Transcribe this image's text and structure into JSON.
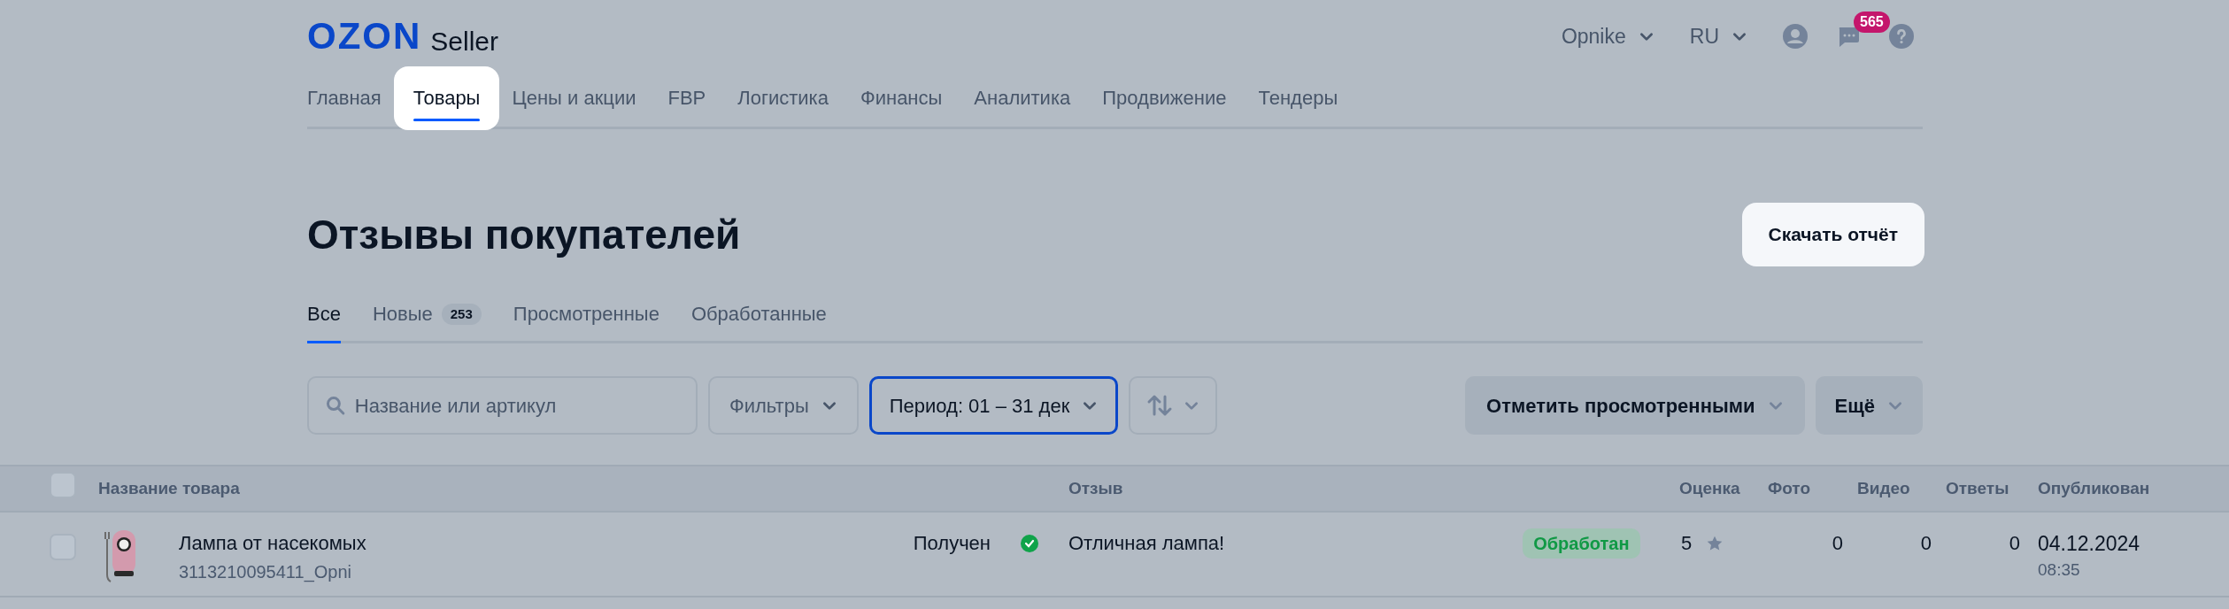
{
  "header": {
    "logo": "OZON",
    "logo_suffix": "Seller",
    "account": "Opnike",
    "language": "RU",
    "messages_badge": "565"
  },
  "nav": [
    {
      "label": "Главная",
      "selected": false
    },
    {
      "label": "Товары",
      "selected": true
    },
    {
      "label": "Цены и акции",
      "selected": false
    },
    {
      "label": "FBP",
      "selected": false
    },
    {
      "label": "Логистика",
      "selected": false
    },
    {
      "label": "Финансы",
      "selected": false
    },
    {
      "label": "Аналитика",
      "selected": false
    },
    {
      "label": "Продвижение",
      "selected": false
    },
    {
      "label": "Тендеры",
      "selected": false
    }
  ],
  "page_title": "Отзывы покупателей",
  "download_button": "Скачать отчёт",
  "tabs": [
    {
      "label": "Все",
      "selected": true
    },
    {
      "label": "Новые",
      "count": "253",
      "selected": false
    },
    {
      "label": "Просмотренные",
      "selected": false
    },
    {
      "label": "Обработанные",
      "selected": false
    }
  ],
  "toolbar": {
    "search_placeholder": "Название или артикул",
    "filters": "Фильтры",
    "period": "Период: 01 – 31 дек",
    "mark_viewed": "Отметить просмотренными",
    "more": "Ещё"
  },
  "table": {
    "select_all_checked": false,
    "columns": [
      "Название товара",
      "Отзыв",
      "Оценка",
      "Фото",
      "Видео",
      "Ответы",
      "Опубликован"
    ],
    "rows": [
      {
        "checked": false,
        "product": "Лампа от насекомых",
        "sku": "3113210095411_Opni",
        "review_status": "Получен",
        "review": "Отличная лампа!",
        "state": "Обработан",
        "rating": "5",
        "photos": "0",
        "videos": "0",
        "answers": "0",
        "date": "04.12.2024",
        "time": "08:35"
      }
    ]
  }
}
